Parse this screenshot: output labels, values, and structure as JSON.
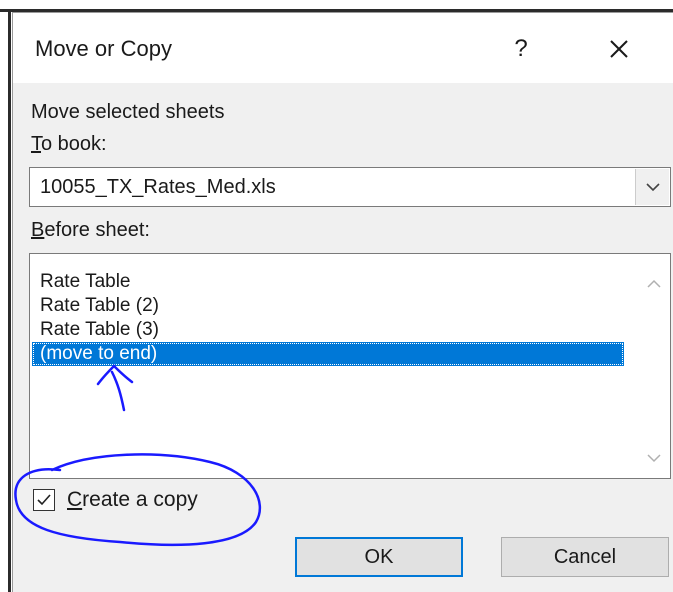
{
  "dialog": {
    "title": "Move or Copy",
    "help_glyph": "?",
    "close_icon": "close-icon",
    "section_label": "Move selected sheets",
    "to_book": {
      "label_mnemonic": "T",
      "label_rest": "o book:",
      "value": "10055_TX_Rates_Med.xls",
      "dropdown_icon": "chevron-down-icon"
    },
    "before_sheet": {
      "label_mnemonic": "B",
      "label_rest": "efore sheet:",
      "items": [
        {
          "label": "Rate Table",
          "selected": false
        },
        {
          "label": "Rate Table (2)",
          "selected": false
        },
        {
          "label": "Rate Table (3)",
          "selected": false
        },
        {
          "label": "(move to end)",
          "selected": true
        }
      ]
    },
    "create_copy": {
      "label_mnemonic": "C",
      "label_rest": "reate a copy",
      "checked": true
    },
    "buttons": {
      "ok": "OK",
      "cancel": "Cancel"
    }
  },
  "colors": {
    "selection": "#0078d7",
    "annotation_ink": "#1a1aff",
    "dialog_bg": "#f0f0f0"
  }
}
